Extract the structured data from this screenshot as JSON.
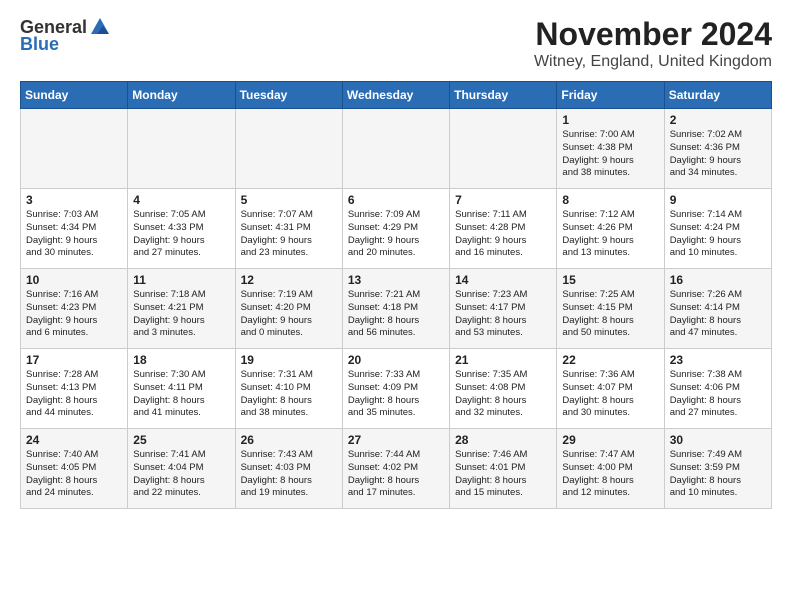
{
  "header": {
    "logo_line1": "General",
    "logo_line2": "Blue",
    "main_title": "November 2024",
    "subtitle": "Witney, England, United Kingdom"
  },
  "days_of_week": [
    "Sunday",
    "Monday",
    "Tuesday",
    "Wednesday",
    "Thursday",
    "Friday",
    "Saturday"
  ],
  "weeks": [
    [
      {
        "day": "",
        "info": ""
      },
      {
        "day": "",
        "info": ""
      },
      {
        "day": "",
        "info": ""
      },
      {
        "day": "",
        "info": ""
      },
      {
        "day": "",
        "info": ""
      },
      {
        "day": "1",
        "info": "Sunrise: 7:00 AM\nSunset: 4:38 PM\nDaylight: 9 hours\nand 38 minutes."
      },
      {
        "day": "2",
        "info": "Sunrise: 7:02 AM\nSunset: 4:36 PM\nDaylight: 9 hours\nand 34 minutes."
      }
    ],
    [
      {
        "day": "3",
        "info": "Sunrise: 7:03 AM\nSunset: 4:34 PM\nDaylight: 9 hours\nand 30 minutes."
      },
      {
        "day": "4",
        "info": "Sunrise: 7:05 AM\nSunset: 4:33 PM\nDaylight: 9 hours\nand 27 minutes."
      },
      {
        "day": "5",
        "info": "Sunrise: 7:07 AM\nSunset: 4:31 PM\nDaylight: 9 hours\nand 23 minutes."
      },
      {
        "day": "6",
        "info": "Sunrise: 7:09 AM\nSunset: 4:29 PM\nDaylight: 9 hours\nand 20 minutes."
      },
      {
        "day": "7",
        "info": "Sunrise: 7:11 AM\nSunset: 4:28 PM\nDaylight: 9 hours\nand 16 minutes."
      },
      {
        "day": "8",
        "info": "Sunrise: 7:12 AM\nSunset: 4:26 PM\nDaylight: 9 hours\nand 13 minutes."
      },
      {
        "day": "9",
        "info": "Sunrise: 7:14 AM\nSunset: 4:24 PM\nDaylight: 9 hours\nand 10 minutes."
      }
    ],
    [
      {
        "day": "10",
        "info": "Sunrise: 7:16 AM\nSunset: 4:23 PM\nDaylight: 9 hours\nand 6 minutes."
      },
      {
        "day": "11",
        "info": "Sunrise: 7:18 AM\nSunset: 4:21 PM\nDaylight: 9 hours\nand 3 minutes."
      },
      {
        "day": "12",
        "info": "Sunrise: 7:19 AM\nSunset: 4:20 PM\nDaylight: 9 hours\nand 0 minutes."
      },
      {
        "day": "13",
        "info": "Sunrise: 7:21 AM\nSunset: 4:18 PM\nDaylight: 8 hours\nand 56 minutes."
      },
      {
        "day": "14",
        "info": "Sunrise: 7:23 AM\nSunset: 4:17 PM\nDaylight: 8 hours\nand 53 minutes."
      },
      {
        "day": "15",
        "info": "Sunrise: 7:25 AM\nSunset: 4:15 PM\nDaylight: 8 hours\nand 50 minutes."
      },
      {
        "day": "16",
        "info": "Sunrise: 7:26 AM\nSunset: 4:14 PM\nDaylight: 8 hours\nand 47 minutes."
      }
    ],
    [
      {
        "day": "17",
        "info": "Sunrise: 7:28 AM\nSunset: 4:13 PM\nDaylight: 8 hours\nand 44 minutes."
      },
      {
        "day": "18",
        "info": "Sunrise: 7:30 AM\nSunset: 4:11 PM\nDaylight: 8 hours\nand 41 minutes."
      },
      {
        "day": "19",
        "info": "Sunrise: 7:31 AM\nSunset: 4:10 PM\nDaylight: 8 hours\nand 38 minutes."
      },
      {
        "day": "20",
        "info": "Sunrise: 7:33 AM\nSunset: 4:09 PM\nDaylight: 8 hours\nand 35 minutes."
      },
      {
        "day": "21",
        "info": "Sunrise: 7:35 AM\nSunset: 4:08 PM\nDaylight: 8 hours\nand 32 minutes."
      },
      {
        "day": "22",
        "info": "Sunrise: 7:36 AM\nSunset: 4:07 PM\nDaylight: 8 hours\nand 30 minutes."
      },
      {
        "day": "23",
        "info": "Sunrise: 7:38 AM\nSunset: 4:06 PM\nDaylight: 8 hours\nand 27 minutes."
      }
    ],
    [
      {
        "day": "24",
        "info": "Sunrise: 7:40 AM\nSunset: 4:05 PM\nDaylight: 8 hours\nand 24 minutes."
      },
      {
        "day": "25",
        "info": "Sunrise: 7:41 AM\nSunset: 4:04 PM\nDaylight: 8 hours\nand 22 minutes."
      },
      {
        "day": "26",
        "info": "Sunrise: 7:43 AM\nSunset: 4:03 PM\nDaylight: 8 hours\nand 19 minutes."
      },
      {
        "day": "27",
        "info": "Sunrise: 7:44 AM\nSunset: 4:02 PM\nDaylight: 8 hours\nand 17 minutes."
      },
      {
        "day": "28",
        "info": "Sunrise: 7:46 AM\nSunset: 4:01 PM\nDaylight: 8 hours\nand 15 minutes."
      },
      {
        "day": "29",
        "info": "Sunrise: 7:47 AM\nSunset: 4:00 PM\nDaylight: 8 hours\nand 12 minutes."
      },
      {
        "day": "30",
        "info": "Sunrise: 7:49 AM\nSunset: 3:59 PM\nDaylight: 8 hours\nand 10 minutes."
      }
    ]
  ]
}
